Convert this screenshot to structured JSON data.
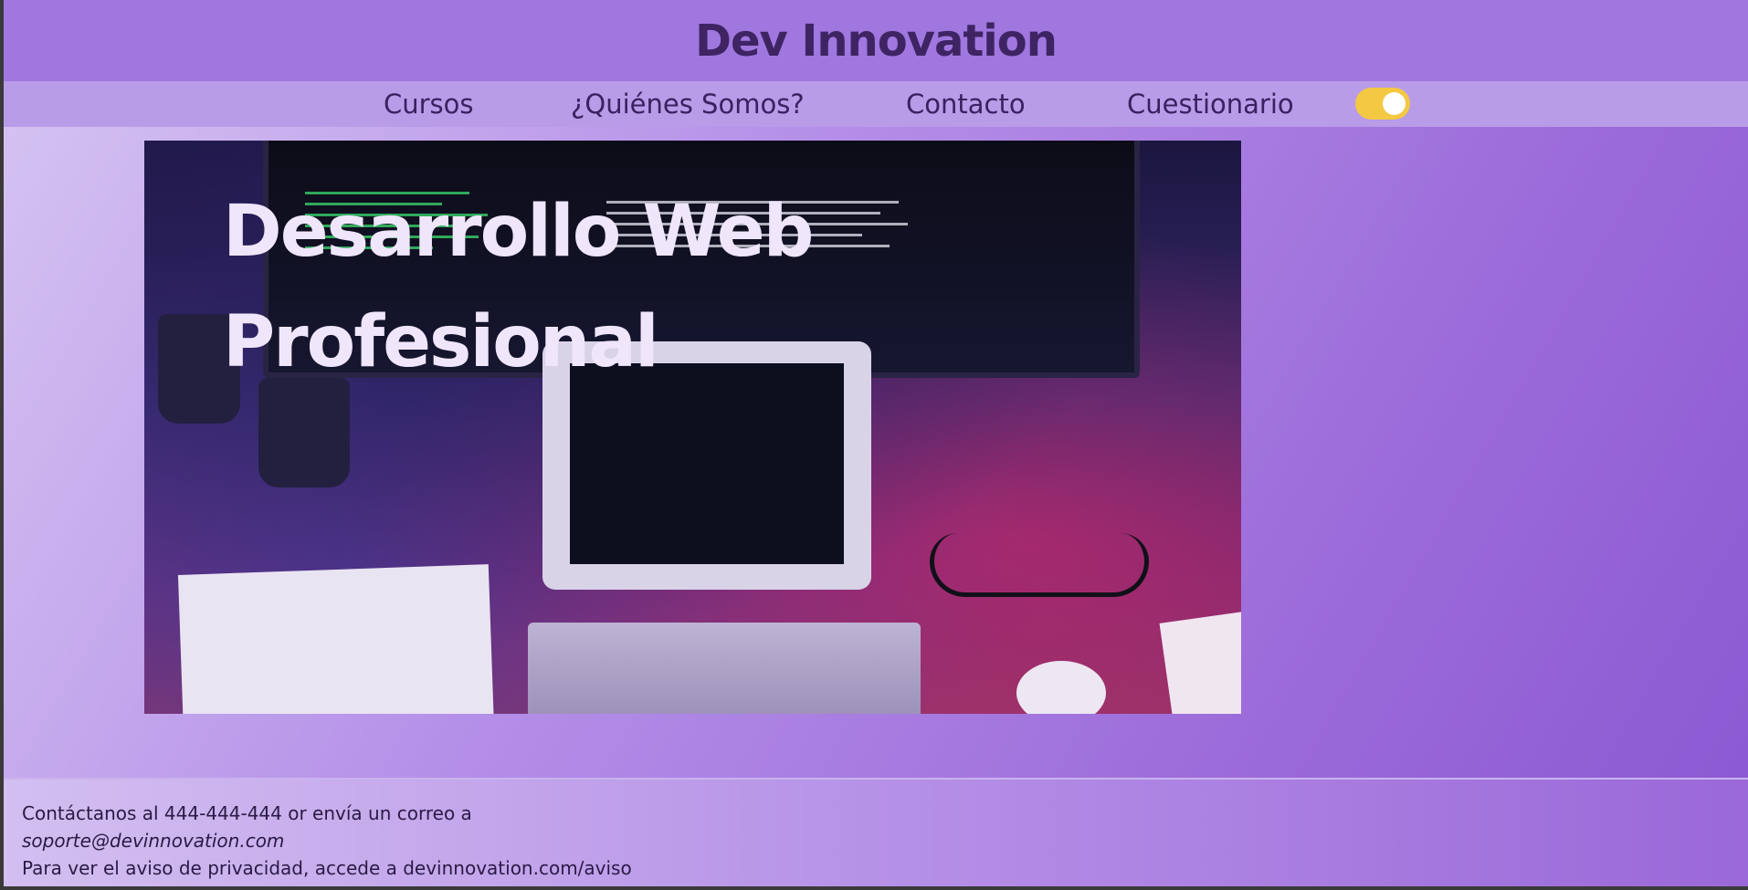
{
  "header": {
    "site_title": "Dev Innovation"
  },
  "nav": {
    "items": [
      {
        "label": "Cursos"
      },
      {
        "label": "¿Quiénes Somos?"
      },
      {
        "label": "Contacto"
      },
      {
        "label": "Cuestionario"
      }
    ],
    "theme_toggle": {
      "state": "on",
      "color": "#f3c843"
    }
  },
  "hero": {
    "title_line1": "Desarrollo Web",
    "title_line2": "Profesional",
    "image_subject": "developer desk with monitor, tablet showing code, keyboard, glasses and flowchart sketch"
  },
  "footer": {
    "contact_line": "Contáctanos al 444-444-444 or envía un correo a",
    "email": "soporte@devinnovation.com",
    "privacy_line": "Para ver el aviso de privacidad, accede a devinnovation.com/aviso"
  },
  "colors": {
    "header_bg": "#a077df",
    "nav_bg": "#b89ce8",
    "title_color": "#3e2463",
    "accent_toggle": "#f3c843"
  }
}
